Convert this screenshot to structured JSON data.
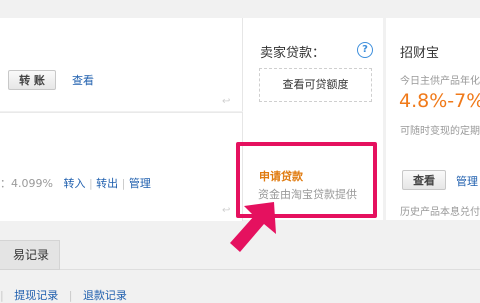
{
  "balance": {
    "transfer_label": "转 账",
    "view_label": "查看",
    "corner_glyph": "↩"
  },
  "yuebao": {
    "rate_text": "：4.099%",
    "transfer_in": "转入",
    "transfer_out": "转出",
    "manage": "管理",
    "separator": "|",
    "corner_glyph": "↩"
  },
  "seller_loan": {
    "title": "卖家贷款：",
    "help_glyph": "?",
    "quota_button": "查看可贷额度",
    "apply_link": "申请贷款",
    "provider_text": "资金由淘宝贷款提供"
  },
  "zhaocaibao": {
    "title": "招财宝",
    "subtitle": "今日主供产品年化",
    "rate": "4.8%-7%",
    "note": "可随时变现的定期",
    "view_button": "查看",
    "manage_link": "管理",
    "history": "历史产品本息兑付"
  },
  "records": {
    "tab_label": "易记录",
    "links": [
      "提现记录",
      "退款记录"
    ],
    "separator": "|"
  },
  "colors": {
    "highlight": "#e5115f",
    "link": "#1f5fae",
    "rate": "#f07a1a",
    "apply_link": "#e07b10"
  }
}
